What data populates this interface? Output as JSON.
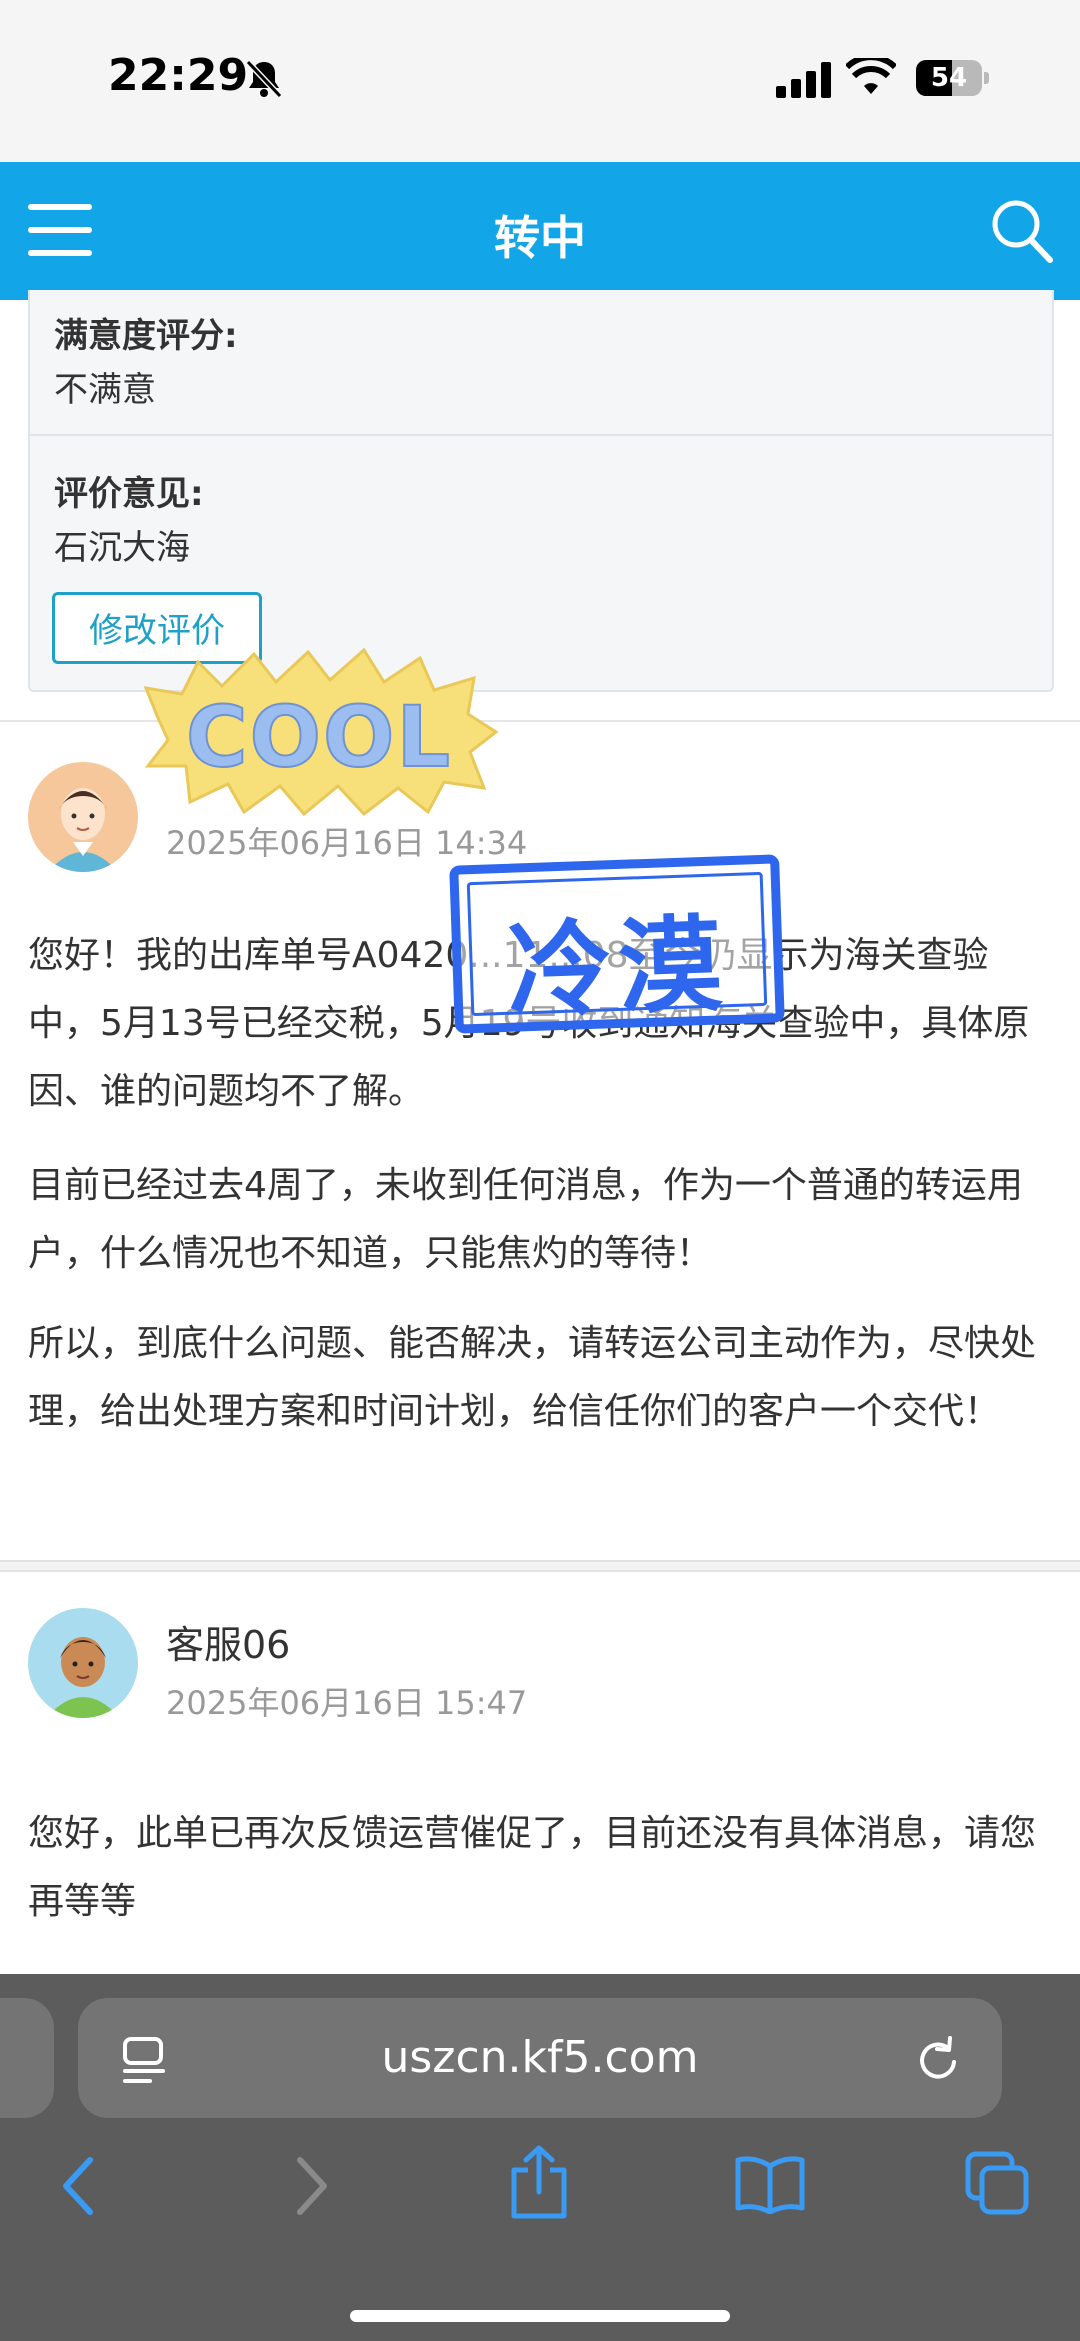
{
  "status_bar": {
    "time": "22:29",
    "battery": "54"
  },
  "navbar": {
    "title": "转中",
    "color": "#12a5e8"
  },
  "rating_card": {
    "satisfaction_label": "满意度评分:",
    "satisfaction_value": "不满意",
    "comment_label": "评价意见:",
    "comment_value": "石沉大海",
    "edit_button": "修改评价"
  },
  "stickers": {
    "cool": "COOL",
    "stamp": "冷漠"
  },
  "messages": [
    {
      "name": "",
      "date": "2025年06月16日 14:34",
      "paragraphs": [
        "您好！我的出库单号A0420...11...08至今仍显示为海关查验中，5月13号已经交税，5月19号收到通知海关查验中，具体原因、谁的问题均不了解。",
        "目前已经过去4周了，未收到任何消息，作为一个普通的转运用户，什么情况也不知道，只能焦灼的等待！",
        "所以，到底什么问题、能否解决，请转运公司主动作为，尽快处理，给出处理方案和时间计划，给信任你们的客户一个交代！"
      ]
    },
    {
      "name": "客服06",
      "date": "2025年06月16日 15:47",
      "paragraphs": [
        "您好，此单已再次反馈运营催促了，目前还没有具体消息，请您再等等"
      ]
    }
  ],
  "browser": {
    "url": "uszcn.kf5.com",
    "accent": "#3a9bf5"
  }
}
